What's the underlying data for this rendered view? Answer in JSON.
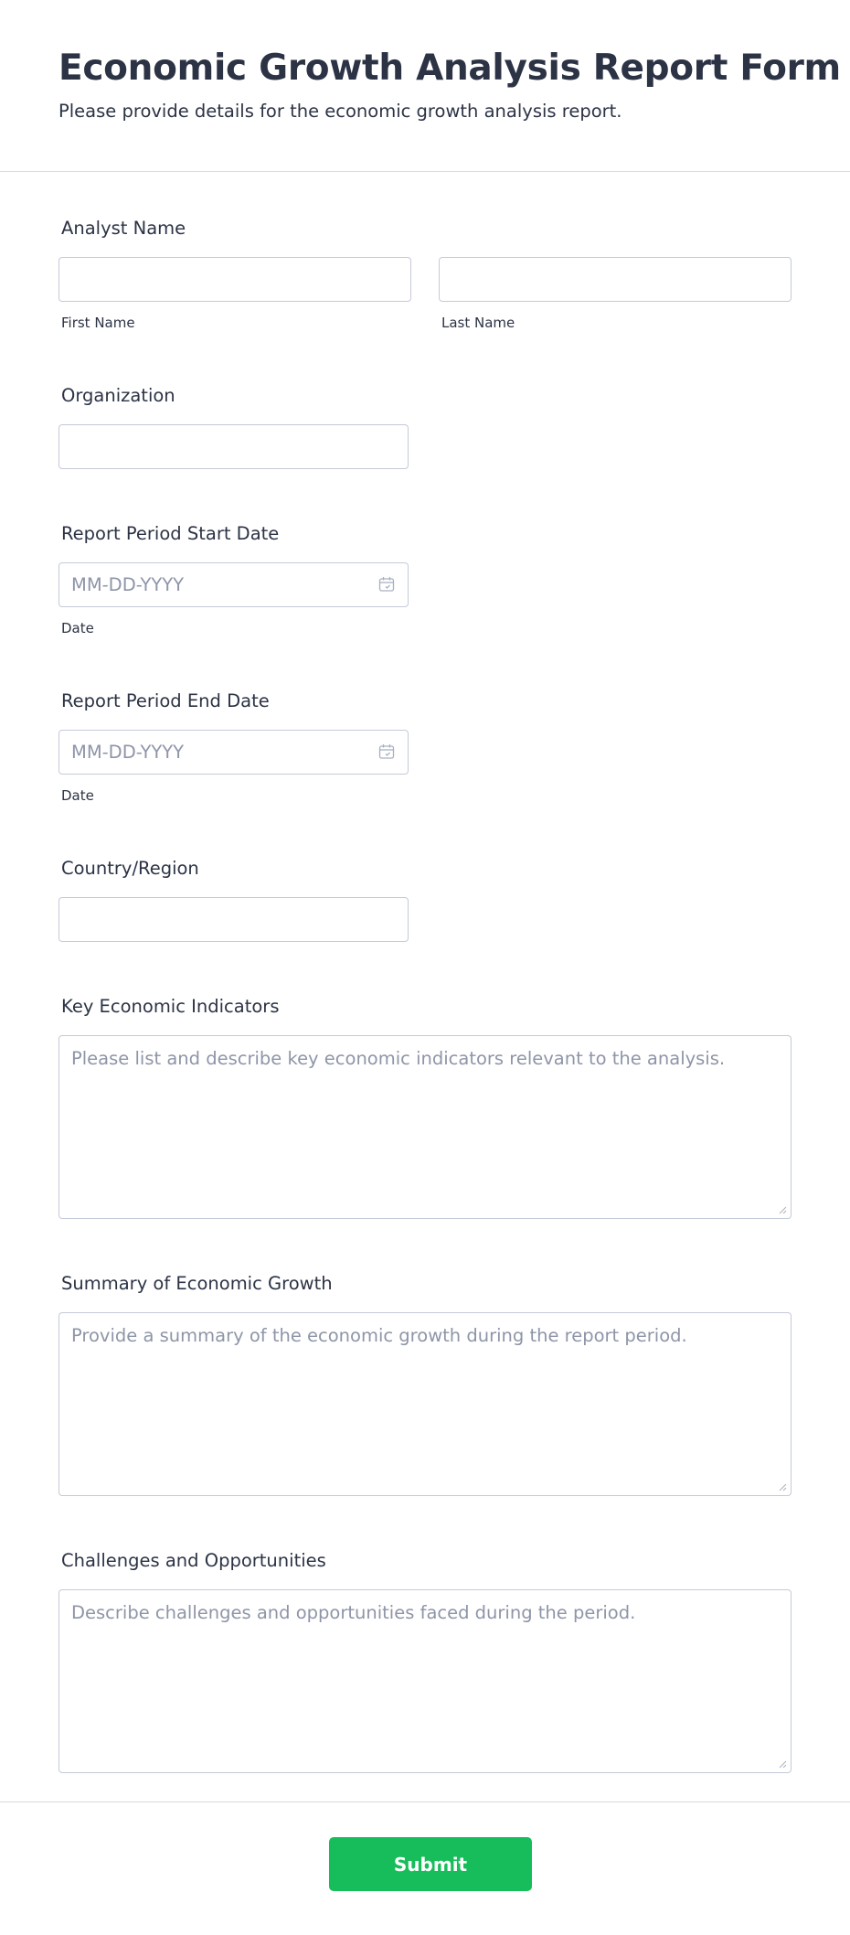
{
  "form": {
    "title": "Economic Growth Analysis Report Form",
    "subtitle": "Please provide details for the economic growth analysis report."
  },
  "fields": {
    "analyst_name": {
      "label": "Analyst Name",
      "first_value": "",
      "first_sublabel": "First Name",
      "last_value": "",
      "last_sublabel": "Last Name"
    },
    "organization": {
      "label": "Organization",
      "value": ""
    },
    "start_date": {
      "label": "Report Period Start Date",
      "placeholder": "MM-DD-YYYY",
      "sublabel": "Date",
      "icon": "calendar-icon"
    },
    "end_date": {
      "label": "Report Period End Date",
      "placeholder": "MM-DD-YYYY",
      "sublabel": "Date",
      "icon": "calendar-icon"
    },
    "country": {
      "label": "Country/Region",
      "value": ""
    },
    "indicators": {
      "label": "Key Economic Indicators",
      "placeholder": "Please list and describe key economic indicators relevant to the analysis."
    },
    "summary": {
      "label": "Summary of Economic Growth",
      "placeholder": "Provide a summary of the economic growth during the report period."
    },
    "challenges": {
      "label": "Challenges and Opportunities",
      "placeholder": "Describe challenges and opportunities faced during the period."
    }
  },
  "submit_label": "Submit",
  "colors": {
    "text": "#2c3345",
    "placeholder": "#8e95a8",
    "border": "#c3cad8",
    "submit_bg": "#18bd5b",
    "submit_text": "#ffffff"
  }
}
